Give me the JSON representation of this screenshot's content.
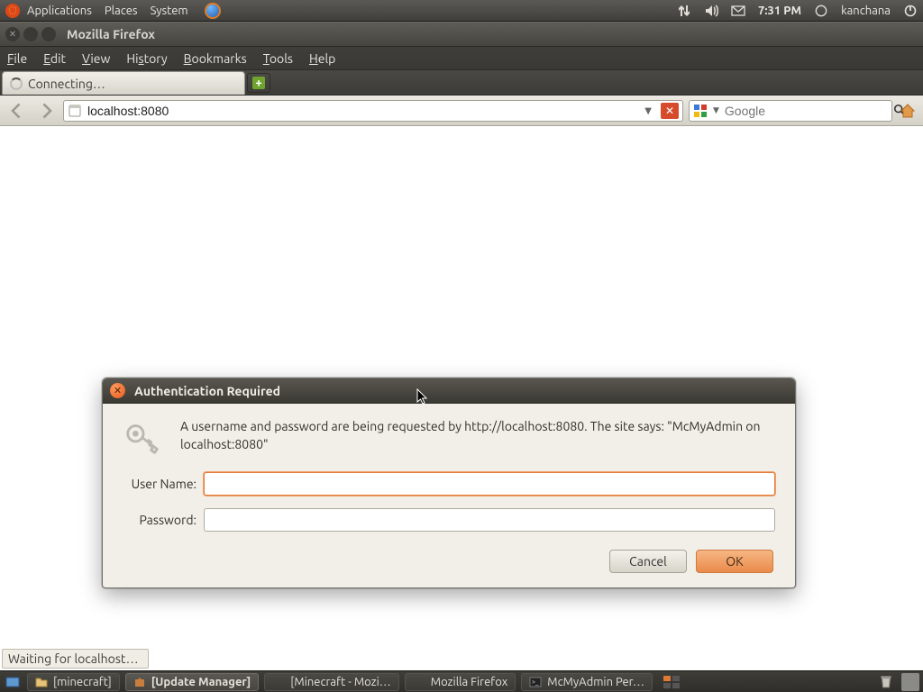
{
  "panel": {
    "menus": [
      "Applications",
      "Places",
      "System"
    ],
    "time": "7:31 PM",
    "user": "kanchana"
  },
  "firefox": {
    "title": "Mozilla Firefox",
    "menu": {
      "file": "File",
      "edit": "Edit",
      "view": "View",
      "history": "History",
      "bookmarks": "Bookmarks",
      "tools": "Tools",
      "help": "Help"
    },
    "tab_label": "Connecting…",
    "url": "localhost:8080",
    "search_placeholder": "Google",
    "status": "Waiting for localhost…"
  },
  "dialog": {
    "title": "Authentication Required",
    "message": "A username and password are being requested by http://localhost:8080. The site says: \"McMyAdmin on localhost:8080\"",
    "username_label": "User Name:",
    "password_label": "Password:",
    "cancel": "Cancel",
    "ok": "OK"
  },
  "taskbar": {
    "items": [
      {
        "label": "[minecraft]"
      },
      {
        "label": "[Update Manager]",
        "active": true
      },
      {
        "label": "[Minecraft - Mozi…"
      },
      {
        "label": "Mozilla Firefox"
      },
      {
        "label": "McMyAdmin Per…"
      }
    ]
  }
}
